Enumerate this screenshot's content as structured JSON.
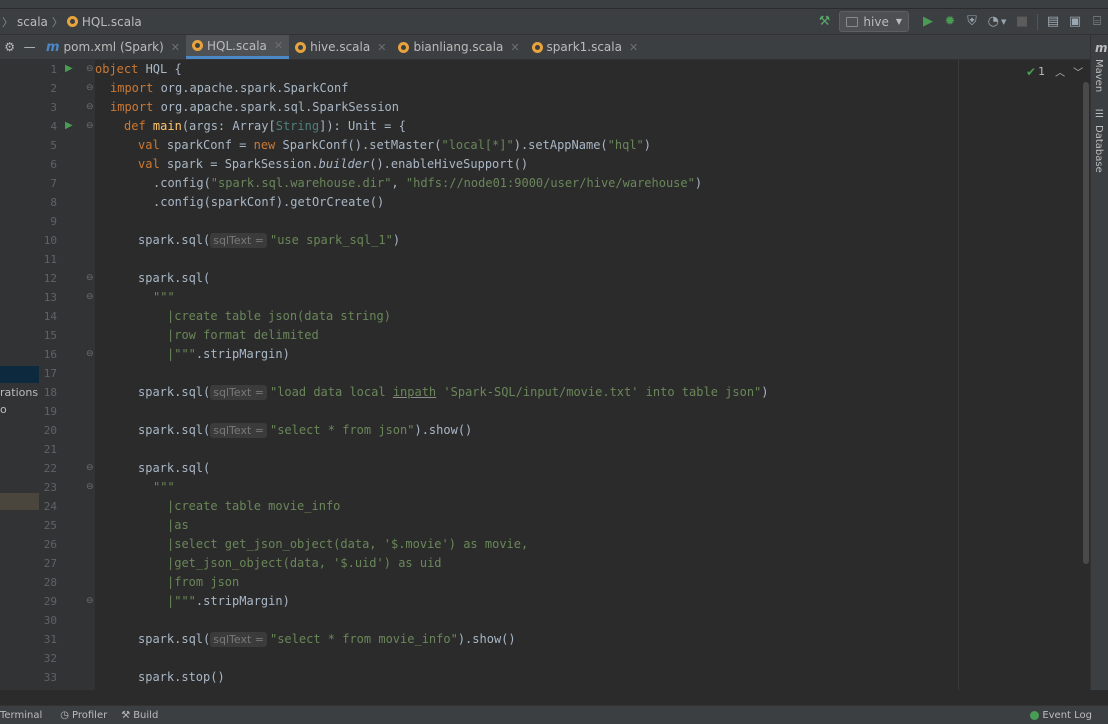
{
  "breadcrumb": [
    "scala",
    "HQL.scala"
  ],
  "run_config": "hive",
  "tabs": [
    {
      "label": "pom.xml (Spark)",
      "icon": "maven-icon",
      "active": false
    },
    {
      "label": "HQL.scala",
      "icon": "scala-file-icon",
      "active": true
    },
    {
      "label": "hive.scala",
      "icon": "scala-file-icon",
      "active": false
    },
    {
      "label": "bianliang.scala",
      "icon": "scala-file-icon",
      "active": false
    },
    {
      "label": "spark1.scala",
      "icon": "scala-file-icon",
      "active": false
    }
  ],
  "sidebar_fragments": [
    "rations",
    "o"
  ],
  "inspection_count": "1",
  "right_tool_windows": [
    "Maven",
    "Database"
  ],
  "bottom_tools": [
    "Terminal",
    "Profiler",
    "Build",
    "Event Log"
  ],
  "code": {
    "line_numbers": [
      "1",
      "2",
      "3",
      "4",
      "5",
      "6",
      "7",
      "8",
      "9",
      "10",
      "11",
      "12",
      "13",
      "14",
      "15",
      "16",
      "17",
      "18",
      "19",
      "20",
      "21",
      "22",
      "23",
      "24",
      "25",
      "26",
      "27",
      "28",
      "29",
      "30",
      "31",
      "32",
      "33"
    ],
    "param_hint": "sqlText =",
    "l1_kw": "object",
    "l1_name": " HQL {",
    "l2_kw": "import",
    "l2_rest": " org.apache.spark.SparkConf",
    "l3_kw": "import",
    "l3_rest": " org.apache.spark.sql.SparkSession",
    "l4_kw": "def",
    "l4_fn": " main",
    "l4_a": "(args: Array[",
    "l4_t": "String",
    "l4_b": "]): Unit = {",
    "l5_kw": "val",
    "l5_a": " sparkConf = ",
    "l5_kw2": "new",
    "l5_b": " SparkConf().setMaster(",
    "l5_s1": "\"local[*]\"",
    "l5_c": ").setAppName(",
    "l5_s2": "\"hql\"",
    "l5_d": ")",
    "l6_kw": "val",
    "l6_a": " spark = SparkSession.",
    "l6_it": "builder",
    "l6_b": "().enableHiveSupport()",
    "l7_a": ".config(",
    "l7_s1": "\"spark.sql.warehouse.dir\"",
    "l7_b": ", ",
    "l7_s2": "\"hdfs://node01:9000/user/hive/warehouse\"",
    "l7_c": ")",
    "l8": ".config(sparkConf).getOrCreate()",
    "l10_a": "spark.sql(",
    "l10_s": "\"use spark_sql_1\"",
    "l10_b": ")",
    "l12": "spark.sql(",
    "l13": "\"\"\"",
    "l14": "|create table json(data string)",
    "l15": "|row format delimited",
    "l16_s": "|\"\"\"",
    "l16_b": ".stripMargin)",
    "l18_a": "spark.sql(",
    "l18_s1": "\"load data local ",
    "l18_u": "inpath",
    "l18_s2": " 'Spark-SQL/input/movie.txt' into table json\"",
    "l18_b": ")",
    "l20_a": "spark.sql(",
    "l20_s": "\"select * from json\"",
    "l20_b": ").show()",
    "l22": "spark.sql(",
    "l23": "\"\"\"",
    "l24": "|create table movie_info",
    "l25": "|as",
    "l26": "|select get_json_object(data, '$.movie') as movie,",
    "l27": "|get_json_object(data, '$.uid') as uid",
    "l28": "|from json",
    "l29_s": "|\"\"\"",
    "l29_b": ".stripMargin)",
    "l31_a": "spark.sql(",
    "l31_s": "\"select * from movie_info\"",
    "l31_b": ").show()",
    "l33": "spark.stop()"
  }
}
